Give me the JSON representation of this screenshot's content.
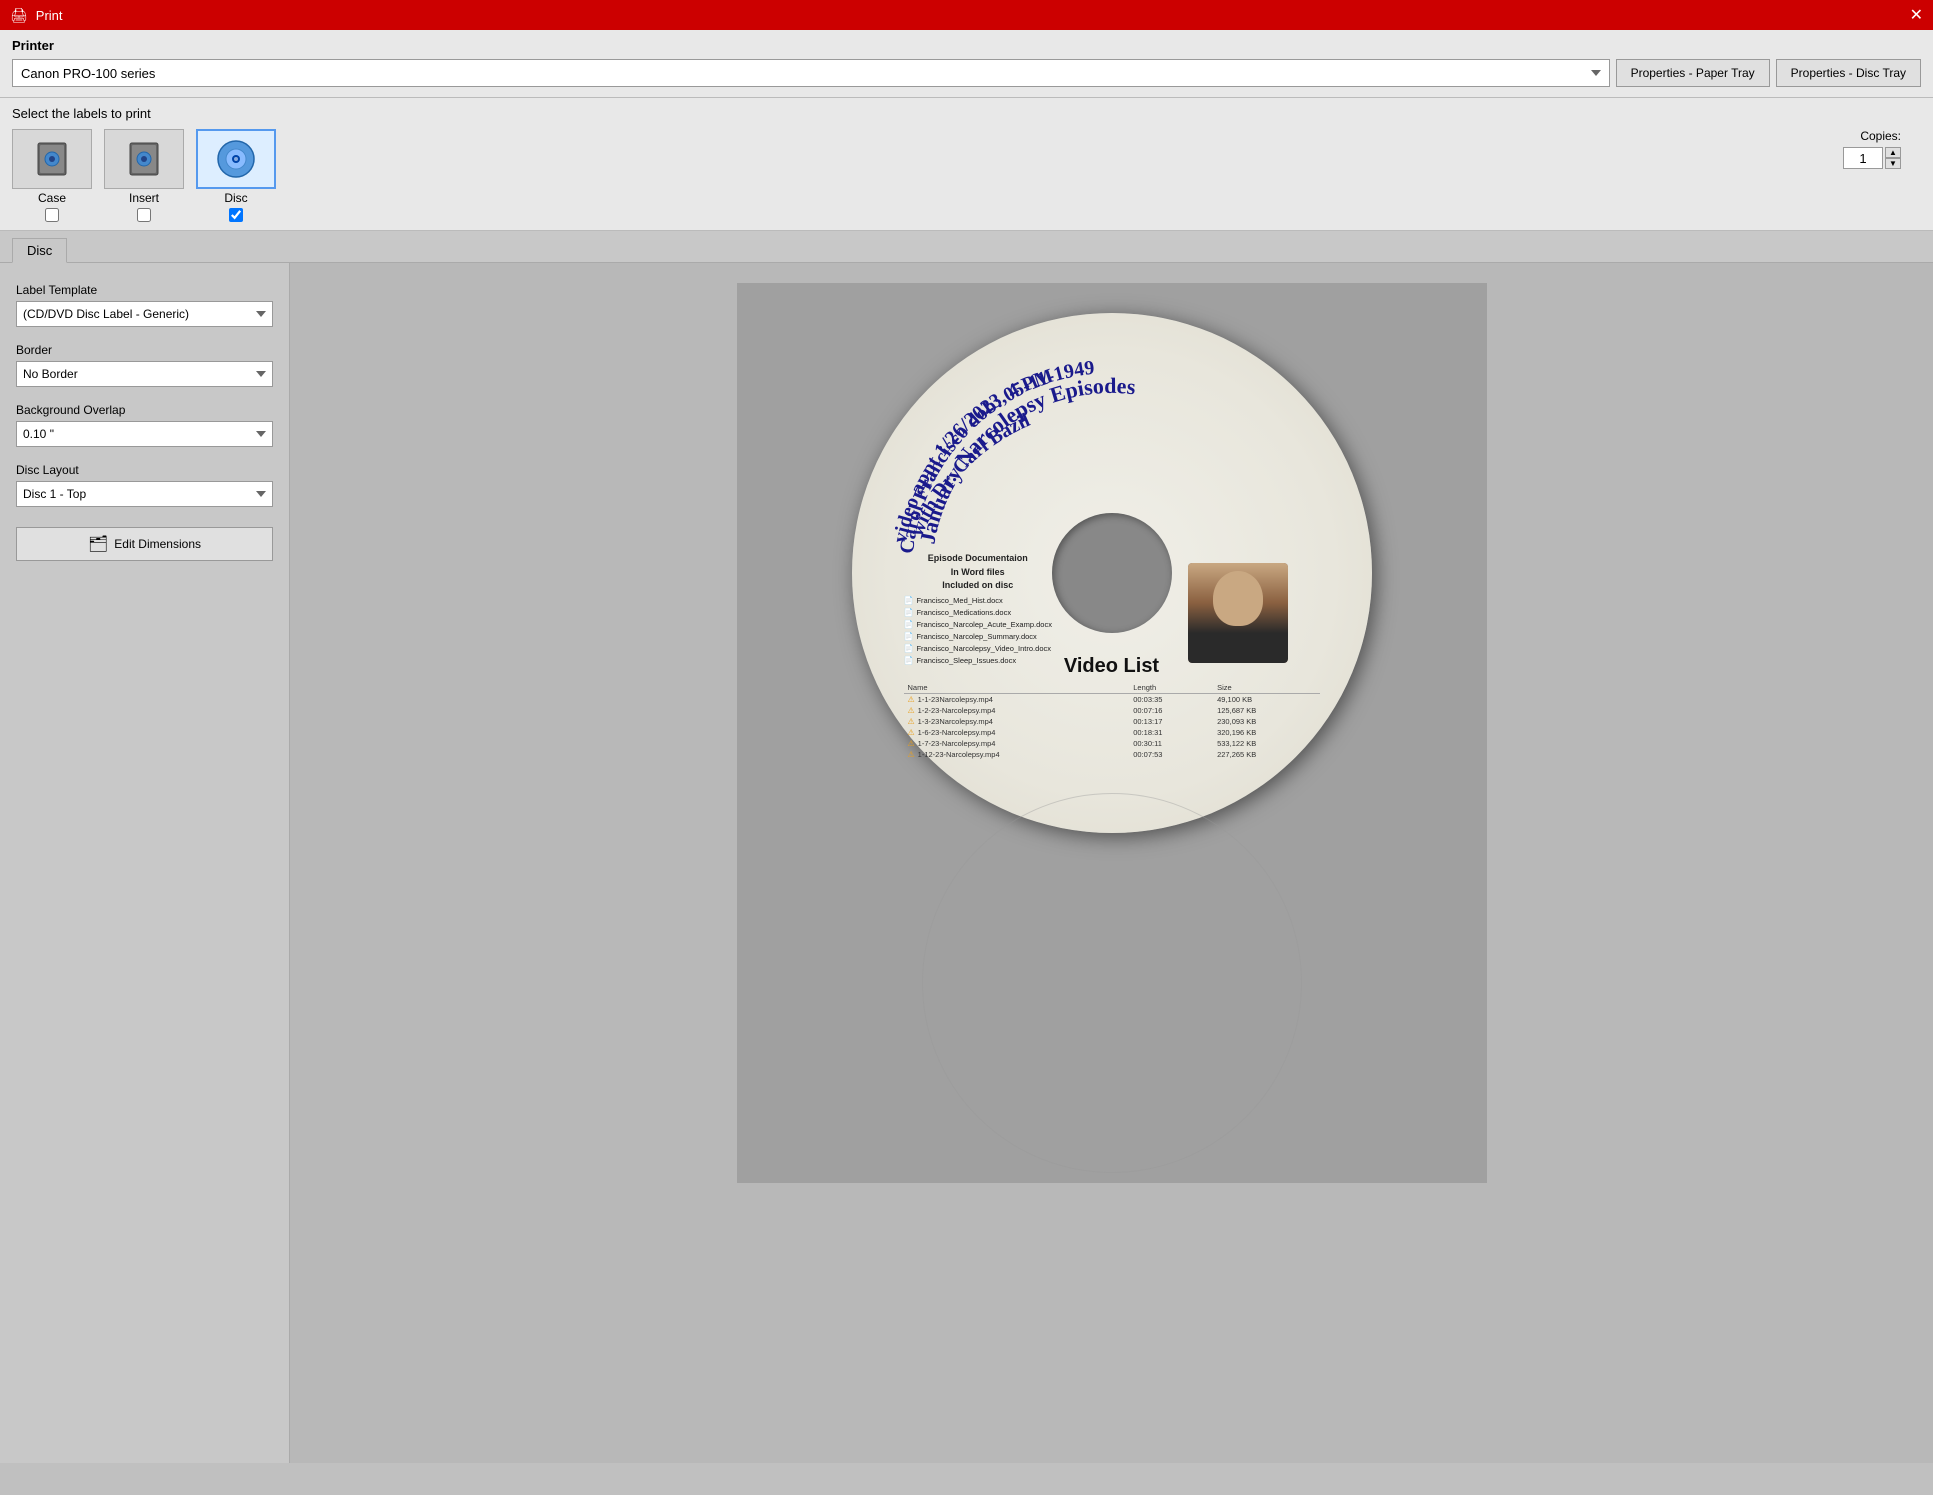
{
  "titlebar": {
    "title": "Print",
    "close_label": "✕"
  },
  "printer": {
    "label": "Printer",
    "selected": "Canon PRO-100 series",
    "options": [
      "Canon PRO-100 series"
    ],
    "btn_paper_tray": "Properties - Paper Tray",
    "btn_disc_tray": "Properties - Disc Tray"
  },
  "labels_section": {
    "title": "Select the labels to print",
    "items": [
      {
        "id": "case",
        "name": "Case",
        "checked": false,
        "selected": false
      },
      {
        "id": "insert",
        "name": "Insert",
        "checked": false,
        "selected": false
      },
      {
        "id": "disc",
        "name": "Disc",
        "checked": true,
        "selected": true
      }
    ],
    "copies_label": "Copies:",
    "copies_value": "1"
  },
  "tabs": [
    {
      "id": "disc",
      "label": "Disc",
      "active": true
    }
  ],
  "left_panel": {
    "label_template_label": "Label Template",
    "label_template_value": "(CD/DVD Disc Label - Generic)",
    "label_template_options": [
      "(CD/DVD Disc Label - Generic)"
    ],
    "border_label": "Border",
    "border_value": "No Border",
    "border_options": [
      "No Border"
    ],
    "background_overlap_label": "Background Overlap",
    "background_overlap_value": "0.10 \"",
    "background_overlap_options": [
      "0.10 \""
    ],
    "disc_layout_label": "Disc Layout",
    "disc_layout_value": "Disc 1 - Top",
    "disc_layout_options": [
      "Disc 1 - Top"
    ],
    "edit_dim_label": "Edit Dimensions"
  },
  "disc_content": {
    "curved_line1": "January Narcolepsy Episodes",
    "curved_line2": "Carol Francisco dob: 05-11-1949",
    "curved_line3": "video appt 1/26/2023, 4 PM",
    "curved_line4": "with Dr. Carl Bazil",
    "doc_title_line1": "Episode Documentaion",
    "doc_title_line2": "In Word files",
    "doc_title_line3": "Included on disc",
    "files": [
      "Francisco_Med_Hist.docx",
      "Francisco_Medications.docx",
      "Francisco_Narcolep_Acute_Examp.docx",
      "Francisco_Narcolep_Summary.docx",
      "Francisco_Narcolepsy_Video_Intro.docx",
      "Francisco_Sleep_Issues.docx"
    ],
    "video_list_title": "Video List",
    "table_headers": [
      "Name",
      "Length",
      "Size"
    ],
    "table_rows": [
      {
        "name": "1-1-23Narcolepsy.mp4",
        "length": "00:03:35",
        "size": "49,100 KB"
      },
      {
        "name": "1-2-23-Narcolepsy.mp4",
        "length": "00:07:16",
        "size": "125,687 KB"
      },
      {
        "name": "1-3-23Narcolepsy.mp4",
        "length": "00:13:17",
        "size": "230,093 KB"
      },
      {
        "name": "1-6-23-Narcolepsy.mp4",
        "length": "00:18:31",
        "size": "320,196 KB"
      },
      {
        "name": "1-7-23-Narcolepsy.mp4",
        "length": "00:30:11",
        "size": "533,122 KB"
      },
      {
        "name": "1-12-23-Narcolepsy.mp4",
        "length": "00:07:53",
        "size": "227,265 KB"
      }
    ]
  }
}
